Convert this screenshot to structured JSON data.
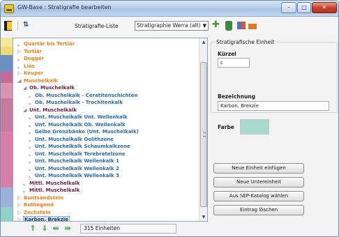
{
  "window": {
    "title": "GW-Base : Stratigrafie bearbeiten",
    "controls": {
      "minimize": "–",
      "maximize": "□",
      "close": "✕"
    }
  },
  "toolbar": {
    "strat_label": "Stratigrafie-Liste",
    "strat_value": "Stratigraphie Werra (alt)",
    "icons": [
      "exit-icon",
      "sort-icon",
      "add-icon",
      "delete-icon",
      "palette-icon",
      "properties-icon"
    ]
  },
  "tree": {
    "items": [
      {
        "label": "Quartär bis Tertiär",
        "color": "#e5811c",
        "icon": "none"
      },
      {
        "label": "Tertiär",
        "color": "#e5811c",
        "icon": "expand-icon"
      },
      {
        "label": "Dogger",
        "color": "#e5811c",
        "icon": "none"
      },
      {
        "label": "Lias",
        "color": "#e5811c",
        "icon": "none"
      },
      {
        "label": "Keuper",
        "color": "#e5811c",
        "icon": "expand-icon"
      },
      {
        "label": "Muschelkalk",
        "color": "#e5811c",
        "icon": "collapse-icon"
      },
      {
        "label": "Ob. Muschelkalk",
        "color": "#6b1f3e",
        "icon": "collapse-icon"
      },
      {
        "label": "Ob. Muschelkalk - Ceratitenschichten",
        "color": "#2c6aa0",
        "icon": "none"
      },
      {
        "label": "Ob. Muschelkalk - Trochitenkalk",
        "color": "#2c6aa0",
        "icon": "none"
      },
      {
        "label": "Unt. Muschelkalk",
        "color": "#6b1f3e",
        "icon": "collapse-icon"
      },
      {
        "label": "Unt. Muschelkalk Unt. Wellenkalk",
        "color": "#2c6aa0",
        "icon": "none"
      },
      {
        "label": "Unt. Muschelkalk Ob. Wellenkalk",
        "color": "#2c6aa0",
        "icon": "none"
      },
      {
        "label": "Gelbe Grenzbänke (Unt. Muschelkalk)",
        "color": "#2c6aa0",
        "icon": "none"
      },
      {
        "label": "Unt. Muschelkalk Oolithzone",
        "color": "#2c6aa0",
        "icon": "none"
      },
      {
        "label": "Unt. Muschelkalk Schaumkalkzone",
        "color": "#2c6aa0",
        "icon": "none"
      },
      {
        "label": "Unt. Muschelkalk Terebratelzone",
        "color": "#2c6aa0",
        "icon": "none"
      },
      {
        "label": "Unt. Muschelkalk Wellenkalk 1",
        "color": "#2c6aa0",
        "icon": "none"
      },
      {
        "label": "Unt. Muschelkalk Wellenkalk 2",
        "color": "#2c6aa0",
        "icon": "none"
      },
      {
        "label": "Unt. Muschelkalk Wellenkalk 3",
        "color": "#2c6aa0",
        "icon": "none"
      },
      {
        "label": "Mittl. Muschelkalk",
        "color": "#6b1f3e",
        "icon": "none"
      },
      {
        "label": "Mittl. Muschelkalk",
        "color": "#6b1f3e",
        "icon": "none"
      },
      {
        "label": "Buntsandstein",
        "color": "#e5811c",
        "icon": "expand-icon"
      },
      {
        "label": "Rotliegend",
        "color": "#e5811c",
        "icon": "expand-icon"
      },
      {
        "label": "Zechstein",
        "color": "#e5811c",
        "icon": "expand-icon"
      },
      {
        "label": "Karbon, Brekzie",
        "color": "#1a3a6a",
        "icon": "expand-icon"
      }
    ],
    "strip_colors": [
      "#f6e89a",
      "#f2d975",
      "#6a8fc3",
      "#6a8fc3",
      "#c56a9a",
      "#d994b4",
      "#c87aa1",
      "#d97fa7",
      "#d97fa7",
      "#9bb1d9",
      "#8ed2c9"
    ]
  },
  "bottom": {
    "count_label": "315 Einheiten",
    "nav_icons": [
      "move-first-icon",
      "move-down-icon",
      "move-left-icon",
      "move-right-icon"
    ]
  },
  "detail": {
    "group_title": "Stratigrafische Einheit",
    "kuerzel_label": "Kürzel",
    "kuerzel_value": "c",
    "bezeichnung_label": "Bezeichnung",
    "bezeichnung_value": "Karbon, Brekzie",
    "farbe_label": "Farbe",
    "farbe_color": "#a9d8cf"
  },
  "actions": {
    "neue_einheit": "Neue Einheit einfügen",
    "neue_untereinheit": "Neue Untereinheit",
    "sep_katalog": "Aus SEP-Katalog wählen",
    "eintrag_loeschen": "Eintrag löschen"
  }
}
